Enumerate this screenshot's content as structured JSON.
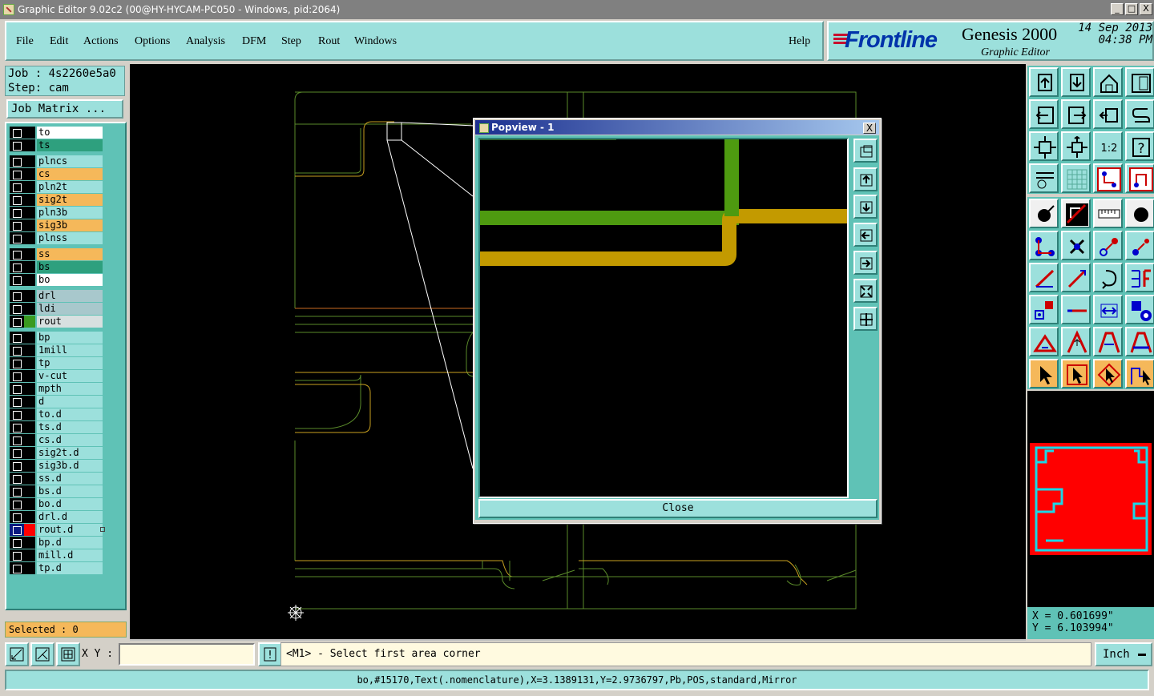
{
  "window": {
    "title": "Graphic Editor 9.02c2 (00@HY-HYCAM-PC050 - Windows, pid:2064)",
    "buttons": [
      "_",
      "□",
      "X"
    ]
  },
  "menu": {
    "items": [
      "File",
      "Edit",
      "Actions",
      "Options",
      "Analysis",
      "DFM",
      "Step",
      "Rout",
      "Windows"
    ],
    "help": "Help"
  },
  "brand": {
    "logo": "Frontline",
    "product": "Genesis 2000",
    "subtitle": "Graphic Editor",
    "date": "14 Sep 2013",
    "time": "04:38 PM"
  },
  "job": {
    "job_line": "Job : 4s2260e5a0",
    "step_line": "Step: cam",
    "matrix_button": "Job Matrix ..."
  },
  "layers": [
    {
      "name": "to",
      "color": "#ffffff"
    },
    {
      "name": "ts",
      "color": "#2ea07e"
    },
    {
      "name": "plncs",
      "color": "#9ce0dc"
    },
    {
      "name": "cs",
      "color": "#f5b85a"
    },
    {
      "name": "pln2t",
      "color": "#9ce0dc"
    },
    {
      "name": "sig2t",
      "color": "#f5b85a"
    },
    {
      "name": "pln3b",
      "color": "#9ce0dc"
    },
    {
      "name": "sig3b",
      "color": "#f5b85a"
    },
    {
      "name": "plnss",
      "color": "#9ce0dc"
    },
    {
      "name": "ss",
      "color": "#f5b85a"
    },
    {
      "name": "bs",
      "color": "#2ea07e"
    },
    {
      "name": "bo",
      "color": "#ffffff"
    },
    {
      "name": "drl",
      "color": "#a8c8cc"
    },
    {
      "name": "ldi",
      "color": "#a8c8cc"
    },
    {
      "name": "rout",
      "color": "#d8e0e0",
      "swatch": "#3a9a20"
    },
    {
      "name": "bp",
      "color": "#9ce0dc"
    },
    {
      "name": "1mill",
      "color": "#9ce0dc"
    },
    {
      "name": "tp",
      "color": "#9ce0dc"
    },
    {
      "name": "v-cut",
      "color": "#9ce0dc"
    },
    {
      "name": "mpth",
      "color": "#9ce0dc"
    },
    {
      "name": "d",
      "color": "#9ce0dc"
    },
    {
      "name": "to.d",
      "color": "#9ce0dc"
    },
    {
      "name": "ts.d",
      "color": "#9ce0dc"
    },
    {
      "name": "cs.d",
      "color": "#9ce0dc"
    },
    {
      "name": "sig2t.d",
      "color": "#9ce0dc"
    },
    {
      "name": "sig3b.d",
      "color": "#9ce0dc"
    },
    {
      "name": "ss.d",
      "color": "#9ce0dc"
    },
    {
      "name": "bs.d",
      "color": "#9ce0dc"
    },
    {
      "name": "bo.d",
      "color": "#9ce0dc"
    },
    {
      "name": "drl.d",
      "color": "#9ce0dc"
    },
    {
      "name": "rout.d",
      "color": "#9ce0dc",
      "swatch": "#ff0000",
      "selected": true
    },
    {
      "name": "bp.d",
      "color": "#9ce0dc"
    },
    {
      "name": "mill.d",
      "color": "#9ce0dc"
    },
    {
      "name": "tp.d",
      "color": "#9ce0dc"
    }
  ],
  "selected_text": "Selected : 0",
  "popview": {
    "title": "Popview - 1",
    "close_button": "Close",
    "close_x": "X"
  },
  "coords": {
    "x": "X = 0.601699\"",
    "y": "Y = 6.103994\""
  },
  "command": {
    "xy_label": "X Y :",
    "xy_value": "",
    "info_button": "!",
    "prompt": "<M1> - Select first area corner",
    "unit": "Inch"
  },
  "status": "bo,#15170,Text(.nomenclature),X=3.1389131,Y=2.9736797,Pb,POS,standard,Mirror",
  "colors": {
    "canvas_bg": "#000000",
    "panel": "#9ce0dc",
    "rout_green": "#4e9a10",
    "signal_orange": "#c39a00",
    "minimap_bg": "#ff0000"
  }
}
